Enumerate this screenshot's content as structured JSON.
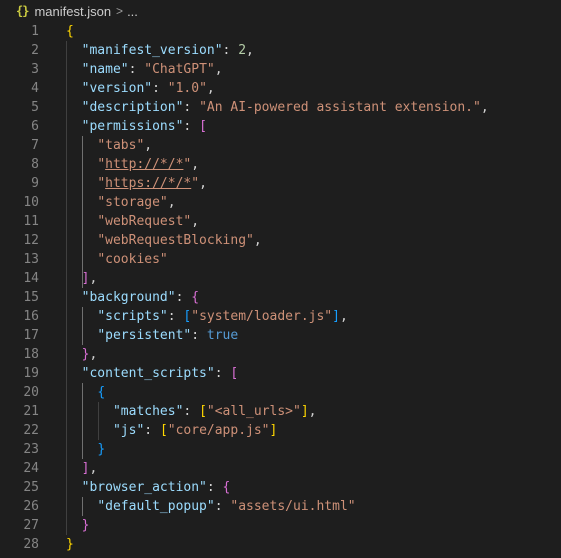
{
  "breadcrumb": {
    "icon": "{}",
    "file": "manifest.json",
    "separator": ">",
    "more": "..."
  },
  "colors": {
    "background": "#1e1e1e",
    "key": "#9cdcfe",
    "string": "#ce9178",
    "number": "#b5cea8",
    "boolean": "#569cd6",
    "bracket_level_1": "#ffd700",
    "bracket_level_2": "#da70d6",
    "bracket_level_3": "#179fff",
    "line_number": "#858585"
  },
  "lines": [
    [
      {
        "t": "{",
        "c": "b1"
      }
    ],
    [
      {
        "t": "  "
      },
      {
        "t": "\"manifest_version\"",
        "c": "k"
      },
      {
        "t": ": ",
        "c": "p"
      },
      {
        "t": "2",
        "c": "n"
      },
      {
        "t": ",",
        "c": "p"
      }
    ],
    [
      {
        "t": "  "
      },
      {
        "t": "\"name\"",
        "c": "k"
      },
      {
        "t": ": ",
        "c": "p"
      },
      {
        "t": "\"ChatGPT\"",
        "c": "s"
      },
      {
        "t": ",",
        "c": "p"
      }
    ],
    [
      {
        "t": "  "
      },
      {
        "t": "\"version\"",
        "c": "k"
      },
      {
        "t": ": ",
        "c": "p"
      },
      {
        "t": "\"1.0\"",
        "c": "s"
      },
      {
        "t": ",",
        "c": "p"
      }
    ],
    [
      {
        "t": "  "
      },
      {
        "t": "\"description\"",
        "c": "k"
      },
      {
        "t": ": ",
        "c": "p"
      },
      {
        "t": "\"An AI-powered assistant extension.\"",
        "c": "s"
      },
      {
        "t": ",",
        "c": "p"
      }
    ],
    [
      {
        "t": "  "
      },
      {
        "t": "\"permissions\"",
        "c": "k"
      },
      {
        "t": ": ",
        "c": "p"
      },
      {
        "t": "[",
        "c": "b2"
      }
    ],
    [
      {
        "t": "    "
      },
      {
        "t": "\"tabs\"",
        "c": "s"
      },
      {
        "t": ",",
        "c": "p"
      }
    ],
    [
      {
        "t": "    "
      },
      {
        "t": "\""
      },
      {
        "t": "http://*/*",
        "c": "s ul"
      },
      {
        "t": "\"",
        "c": "s"
      },
      {
        "t": ",",
        "c": "p"
      }
    ],
    [
      {
        "t": "    "
      },
      {
        "t": "\"",
        "c": "s"
      },
      {
        "t": "https://*/*",
        "c": "s ul"
      },
      {
        "t": "\"",
        "c": "s"
      },
      {
        "t": ",",
        "c": "p"
      }
    ],
    [
      {
        "t": "    "
      },
      {
        "t": "\"storage\"",
        "c": "s"
      },
      {
        "t": ",",
        "c": "p"
      }
    ],
    [
      {
        "t": "    "
      },
      {
        "t": "\"webRequest\"",
        "c": "s"
      },
      {
        "t": ",",
        "c": "p"
      }
    ],
    [
      {
        "t": "    "
      },
      {
        "t": "\"webRequestBlocking\"",
        "c": "s"
      },
      {
        "t": ",",
        "c": "p"
      }
    ],
    [
      {
        "t": "    "
      },
      {
        "t": "\"cookies\"",
        "c": "s"
      }
    ],
    [
      {
        "t": "  "
      },
      {
        "t": "]",
        "c": "b2"
      },
      {
        "t": ",",
        "c": "p"
      }
    ],
    [
      {
        "t": "  "
      },
      {
        "t": "\"background\"",
        "c": "k"
      },
      {
        "t": ": ",
        "c": "p"
      },
      {
        "t": "{",
        "c": "b2"
      }
    ],
    [
      {
        "t": "    "
      },
      {
        "t": "\"scripts\"",
        "c": "k"
      },
      {
        "t": ": ",
        "c": "p"
      },
      {
        "t": "[",
        "c": "b3"
      },
      {
        "t": "\"system/loader.js\"",
        "c": "s"
      },
      {
        "t": "]",
        "c": "b3"
      },
      {
        "t": ",",
        "c": "p"
      }
    ],
    [
      {
        "t": "    "
      },
      {
        "t": "\"persistent\"",
        "c": "k"
      },
      {
        "t": ": ",
        "c": "p"
      },
      {
        "t": "true",
        "c": "bl"
      }
    ],
    [
      {
        "t": "  "
      },
      {
        "t": "}",
        "c": "b2"
      },
      {
        "t": ",",
        "c": "p"
      }
    ],
    [
      {
        "t": "  "
      },
      {
        "t": "\"content_scripts\"",
        "c": "k"
      },
      {
        "t": ": ",
        "c": "p"
      },
      {
        "t": "[",
        "c": "b2"
      }
    ],
    [
      {
        "t": "    "
      },
      {
        "t": "{",
        "c": "b3"
      }
    ],
    [
      {
        "t": "      "
      },
      {
        "t": "\"matches\"",
        "c": "k"
      },
      {
        "t": ": ",
        "c": "p"
      },
      {
        "t": "[",
        "c": "b1"
      },
      {
        "t": "\"<all_urls>\"",
        "c": "s"
      },
      {
        "t": "]",
        "c": "b1"
      },
      {
        "t": ",",
        "c": "p"
      }
    ],
    [
      {
        "t": "      "
      },
      {
        "t": "\"js\"",
        "c": "k"
      },
      {
        "t": ": ",
        "c": "p"
      },
      {
        "t": "[",
        "c": "b1"
      },
      {
        "t": "\"core/app.js\"",
        "c": "s"
      },
      {
        "t": "]",
        "c": "b1"
      }
    ],
    [
      {
        "t": "    "
      },
      {
        "t": "}",
        "c": "b3"
      }
    ],
    [
      {
        "t": "  "
      },
      {
        "t": "]",
        "c": "b2"
      },
      {
        "t": ",",
        "c": "p"
      }
    ],
    [
      {
        "t": "  "
      },
      {
        "t": "\"browser_action\"",
        "c": "k"
      },
      {
        "t": ": ",
        "c": "p"
      },
      {
        "t": "{",
        "c": "b2"
      }
    ],
    [
      {
        "t": "    "
      },
      {
        "t": "\"default_popup\"",
        "c": "k"
      },
      {
        "t": ": ",
        "c": "p"
      },
      {
        "t": "\"assets/ui.html\"",
        "c": "s"
      }
    ],
    [
      {
        "t": "  "
      },
      {
        "t": "}",
        "c": "b2"
      }
    ],
    [
      {
        "t": "}",
        "c": "b1"
      }
    ]
  ]
}
